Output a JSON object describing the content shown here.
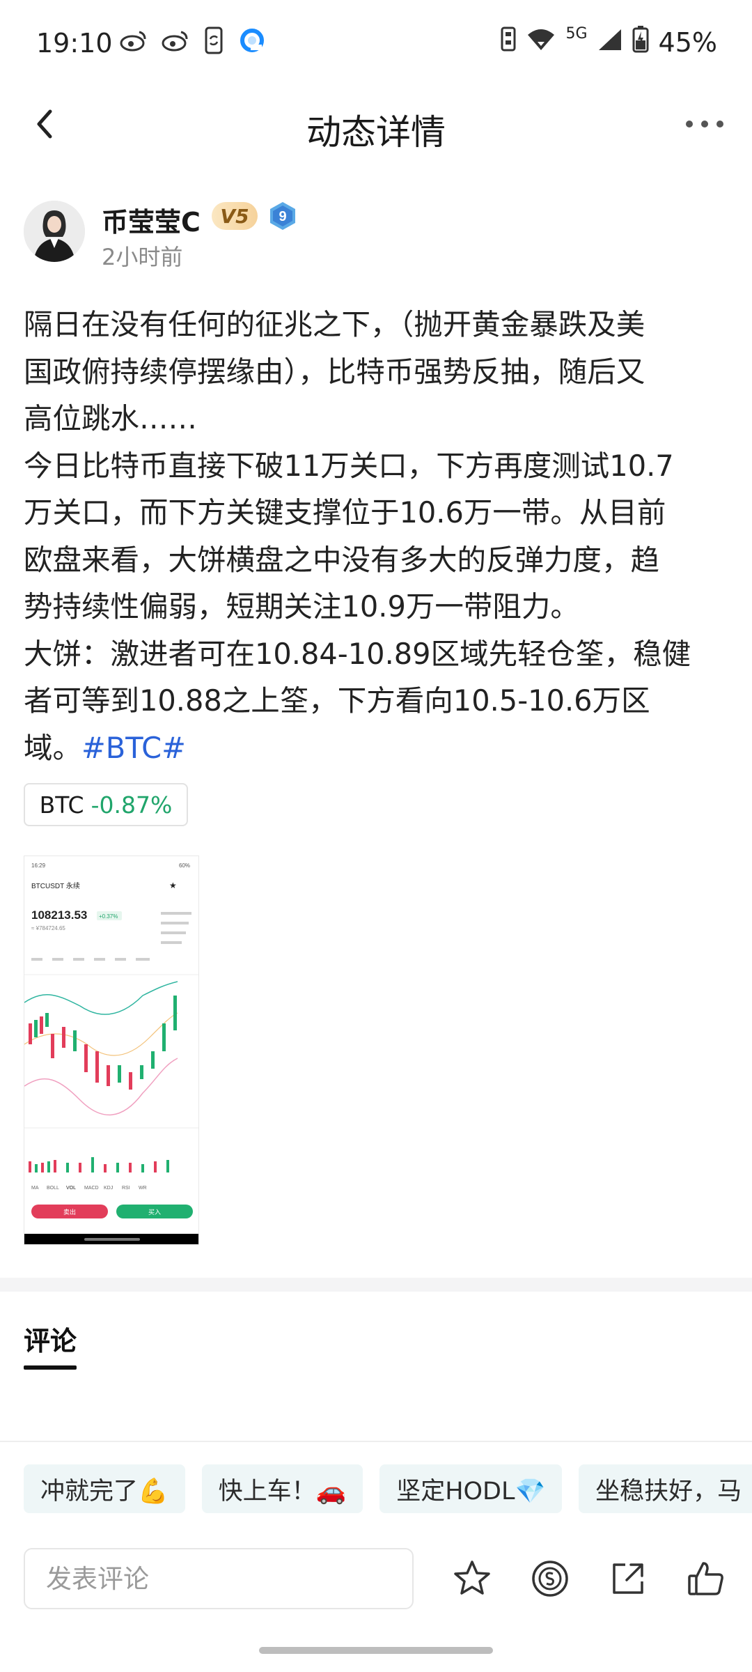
{
  "status_bar": {
    "time": "19:10",
    "network": "5G",
    "battery": "45%",
    "icons_left": [
      "weibo-icon",
      "weibo-icon",
      "phone-sync-icon",
      "browser-icon"
    ],
    "icons_right": [
      "nfc-icon",
      "wifi-icon",
      "signal-icon",
      "battery-icon"
    ]
  },
  "nav": {
    "title": "动态详情"
  },
  "author": {
    "name": "币莹莹C",
    "vip_badge": "V5",
    "level_badge": "9",
    "time_ago": "2小时前"
  },
  "post": {
    "lines": [
      "隔日在没有任何的征兆之下，（抛开黄金暴跌及美",
      "国政俯持续停摆缘由），比特币强势反抽，随后又",
      "高位跳水……",
      "今日比特币直接下破11万关口，下方再度测试10.7",
      "万关口，而下方关键支撑位于10.6万一带。从目前",
      "欧盘来看，大饼横盘之中没有多大的反弹力度，趋",
      "势持续性偏弱，短期关注10.9万一带阻力。",
      "大饼：激进者可在10.84-10.89区域先轻仓筌，稳健",
      "者可等到10.88之上筌，下方看向10.5-10.6万区"
    ],
    "last_line": "域。",
    "hashtag": "#BTC#"
  },
  "ticker": {
    "symbol": "BTC",
    "change": "-0.87%",
    "change_color": "#20a56b"
  },
  "thumbnail": {
    "status_time": "16:29",
    "status_battery": "60%",
    "pair": "BTCUSDT 永续",
    "price": "108213.53",
    "change_badge": "+0.37%",
    "sub_price": "≈ ¥784724.65",
    "tabs": [
      "MA",
      "BOLL",
      "VOL",
      "MACD",
      "KDJ",
      "RSI",
      "WR"
    ],
    "sell_label": "卖出",
    "buy_label": "买入"
  },
  "comments_tab": {
    "label": "评论"
  },
  "quick_replies": [
    "冲就完了💪",
    "快上车！🚗",
    "坚定HODL💎",
    "坐稳扶好，马"
  ],
  "composer": {
    "placeholder": "发表评论"
  },
  "actions": [
    "star-icon",
    "tip-coin-icon",
    "share-icon",
    "like-icon"
  ]
}
